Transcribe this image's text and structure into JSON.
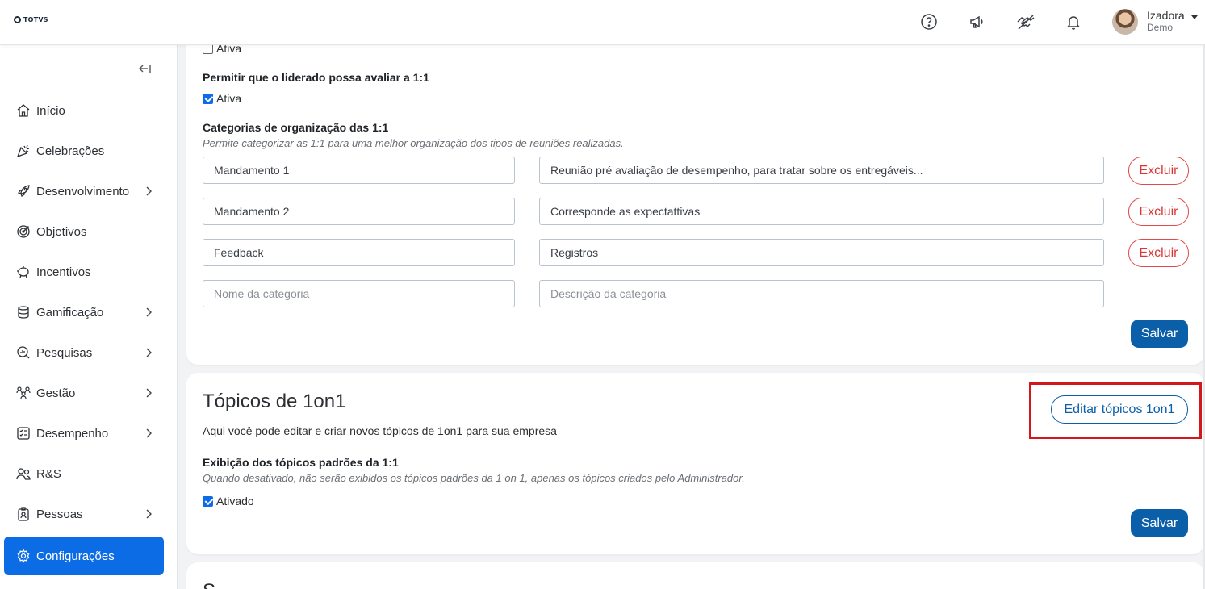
{
  "header": {
    "logo_text": "TOTVS",
    "user_name": "Izadora",
    "user_role": "Demo",
    "icons": [
      "help-icon",
      "megaphone-icon",
      "handshake-icon",
      "bell-icon"
    ]
  },
  "sidebar": {
    "items": [
      {
        "label": "Início",
        "icon": "home-icon",
        "has_submenu": false
      },
      {
        "label": "Celebrações",
        "icon": "party-icon",
        "has_submenu": false
      },
      {
        "label": "Desenvolvimento",
        "icon": "rocket-icon",
        "has_submenu": true
      },
      {
        "label": "Objetivos",
        "icon": "target-icon",
        "has_submenu": false
      },
      {
        "label": "Incentivos",
        "icon": "piggy-bank-icon",
        "has_submenu": false
      },
      {
        "label": "Gamificação",
        "icon": "coins-icon",
        "has_submenu": true
      },
      {
        "label": "Pesquisas",
        "icon": "search-chart-icon",
        "has_submenu": true
      },
      {
        "label": "Gestão",
        "icon": "team-icon",
        "has_submenu": true
      },
      {
        "label": "Desempenho",
        "icon": "checklist-icon",
        "has_submenu": true
      },
      {
        "label": "R&S",
        "icon": "people-icon",
        "has_submenu": false
      },
      {
        "label": "Pessoas",
        "icon": "badge-icon",
        "has_submenu": true
      },
      {
        "label": "Configurações",
        "icon": "gear-icon",
        "has_submenu": false,
        "active": true
      }
    ]
  },
  "card1": {
    "top_checkbox_label": "Ativa",
    "allow_eval_label": "Permitir que o liderado possa avaliar a 1:1",
    "allow_eval_checkbox": "Ativa",
    "categories_title": "Categorias de organização das 1:1",
    "categories_hint": "Permite categorizar as 1:1 para uma melhor organização dos tipos de reuniões realizadas.",
    "rows": [
      {
        "name": "Mandamento 1",
        "description": "Reunião pré avaliação de desempenho, para tratar sobre os entregáveis..."
      },
      {
        "name": "Mandamento 2",
        "description": "Corresponde as expectattivas"
      },
      {
        "name": "Feedback",
        "description": "Registros"
      }
    ],
    "new_name_placeholder": "Nome da categoria",
    "new_desc_placeholder": "Descrição da categoria",
    "delete_label": "Excluir",
    "save_label": "Salvar"
  },
  "card2": {
    "title": "Tópicos de 1on1",
    "subtitle": "Aqui você pode editar e criar novos tópicos de 1on1 para sua empresa",
    "edit_button": "Editar tópicos 1on1",
    "default_topics_title": "Exibição dos tópicos padrões da 1:1",
    "default_topics_hint": "Quando desativado, não serão exibidos os tópicos padrões da 1 on 1, apenas os tópicos criados pelo Administrador.",
    "checkbox_label": "Ativado",
    "save_label": "Salvar"
  },
  "card3": {
    "title_peek": "S"
  },
  "colors": {
    "primary": "#0b5fa8",
    "active_nav": "#0c6ce5",
    "danger": "#d93737",
    "highlight": "#d3171b"
  }
}
